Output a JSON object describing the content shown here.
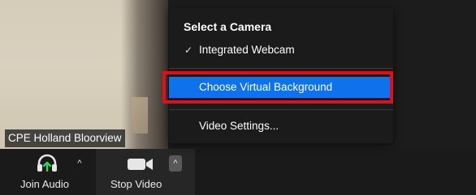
{
  "participant": {
    "name": "CPE Holland Bloorview"
  },
  "toolbar": {
    "join_audio_label": "Join Audio",
    "join_audio_icon": "headphones-arrow-icon",
    "audio_caret": "^",
    "stop_video_label": "Stop Video",
    "stop_video_icon": "video-camera-icon",
    "video_caret": "^",
    "accent_green": "#23d959"
  },
  "camera_menu": {
    "title": "Select a Camera",
    "items": [
      {
        "label": "Integrated Webcam",
        "selected": true,
        "check_glyph": "✓"
      },
      {
        "label": "Choose Virtual Background",
        "highlighted": true
      },
      {
        "label": "Video Settings..."
      }
    ],
    "highlight_color": "#0e72ed",
    "annotation_color": "#e0101b"
  }
}
